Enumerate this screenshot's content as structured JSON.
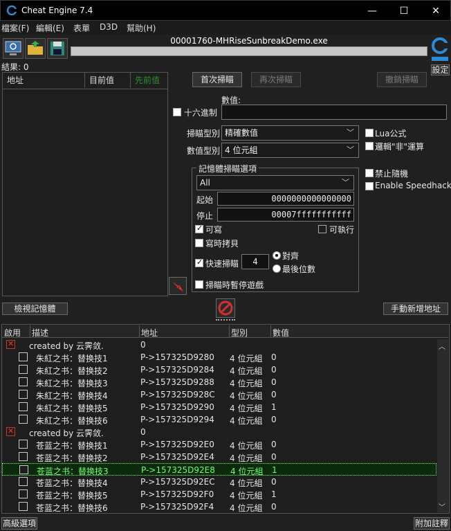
{
  "window": {
    "title": "Cheat Engine 7.4",
    "minimize": "—",
    "maximize": "☐",
    "close": "✕"
  },
  "menu": [
    "檔案(F)",
    "編輯(E)",
    "表單",
    "D3D",
    "幫助(H)"
  ],
  "process": {
    "name": "00001760-MHRiseSunbreakDemo.exe"
  },
  "settings_label": "設定",
  "results_label": "結果: 0",
  "found_list": {
    "col_address": "地址",
    "col_current": "目前值",
    "col_previous": "先前值"
  },
  "scan_buttons": {
    "first": "首次掃瞄",
    "next": "再次掃瞄",
    "undo": "撤銷掃瞄"
  },
  "value": {
    "label": "數值:",
    "hex_label": "十六進制",
    "input": ""
  },
  "scan_type": {
    "label": "掃瞄型別",
    "selected": "精確數值"
  },
  "value_type": {
    "label": "數值型別",
    "selected": "4 位元組"
  },
  "options_right": {
    "lua": "Lua公式",
    "not": "邏輯\"非\"運算",
    "no_random": "禁止隨機",
    "speedhack": "Enable Speedhack"
  },
  "memory_options": {
    "title": "記憶體掃瞄選項",
    "region": "All",
    "start_label": "起始",
    "start_value": "0000000000000000",
    "stop_label": "停止",
    "stop_value": "00007fffffffffff",
    "writable": "可寫",
    "executable": "可執行",
    "copy_on_write": "寫時拷貝",
    "fast_scan": "快速掃瞄",
    "fast_scan_value": "4",
    "align": "對齊",
    "last_digits": "最後位數",
    "pause": "掃瞄時暫停遊戲"
  },
  "bottom_buttons": {
    "memory_view": "檢視記憶體",
    "add_address": "手動新增地址"
  },
  "address_list": {
    "headers": {
      "active": "啟用",
      "description": "描述",
      "address": "地址",
      "type": "型別",
      "value": "數值"
    },
    "rows": [
      {
        "group": true,
        "desc": "created by 云霁敛.",
        "addr": "",
        "type": "",
        "value": "0"
      },
      {
        "desc": "朱紅之书：替换技1",
        "addr": "P->157325D9280",
        "type": "4 位元組",
        "value": "0"
      },
      {
        "desc": "朱紅之书：替换技2",
        "addr": "P->157325D9284",
        "type": "4 位元組",
        "value": "0"
      },
      {
        "desc": "朱紅之书：替换技3",
        "addr": "P->157325D9288",
        "type": "4 位元組",
        "value": "0"
      },
      {
        "desc": "朱紅之书：替换技4",
        "addr": "P->157325D928C",
        "type": "4 位元組",
        "value": "0"
      },
      {
        "desc": "朱紅之书：替换技5",
        "addr": "P->157325D9290",
        "type": "4 位元組",
        "value": "1"
      },
      {
        "desc": "朱紅之书：替换技6",
        "addr": "P->157325D9294",
        "type": "4 位元組",
        "value": "0"
      },
      {
        "group": true,
        "desc": "created by 云霁敛.",
        "addr": "",
        "type": "",
        "value": "0"
      },
      {
        "desc": "苍蓝之书：替换技1",
        "addr": "P->157325D92E0",
        "type": "4 位元組",
        "value": "0"
      },
      {
        "desc": "苍蓝之书：替换技2",
        "addr": "P->157325D92E4",
        "type": "4 位元組",
        "value": "0"
      },
      {
        "desc": "苍蓝之书：替换技3",
        "addr": "P->157325D92E8",
        "type": "4 位元組",
        "value": "1",
        "selected": true
      },
      {
        "desc": "苍蓝之书：替换技4",
        "addr": "P->157325D92EC",
        "type": "4 位元組",
        "value": "0"
      },
      {
        "desc": "苍蓝之书：替换技5",
        "addr": "P->157325D92F0",
        "type": "4 位元組",
        "value": "1"
      },
      {
        "desc": "苍蓝之书：替换技6",
        "addr": "P->157325D92F4",
        "type": "4 位元組",
        "value": "0"
      }
    ]
  },
  "footer": {
    "advanced": "高級選項",
    "extra": "附加註釋"
  },
  "colors": {
    "accent_green": "#6cff6c",
    "previous_value_header": "#2f8f2f",
    "stop_icon": "#d03030"
  }
}
